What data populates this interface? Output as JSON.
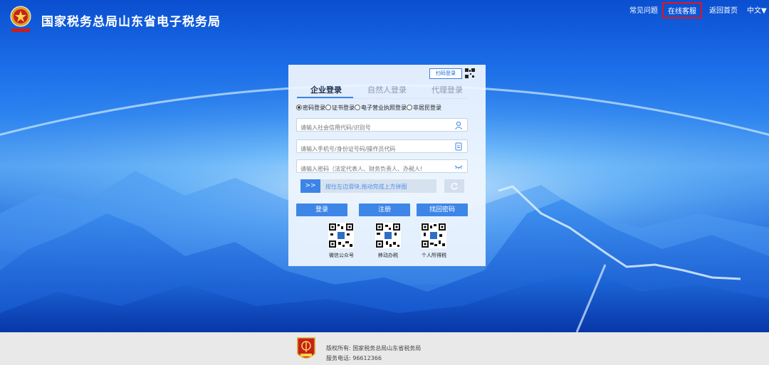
{
  "header": {
    "title": "国家税务总局山东省电子税务局",
    "nav": {
      "faq": "常见问题",
      "online_service": "在线客服",
      "home": "返回首页",
      "language": "中文▼"
    }
  },
  "login": {
    "scan_login": "扫码登录",
    "tabs": [
      {
        "label": "企业登录",
        "active": true
      },
      {
        "label": "自然人登录",
        "active": false
      },
      {
        "label": "代理登录",
        "active": false
      }
    ],
    "modes": [
      {
        "label": "密码登录",
        "selected": true
      },
      {
        "label": "证书登录",
        "selected": false
      },
      {
        "label": "电子营业执照登录",
        "selected": false
      },
      {
        "label": "非居民登录",
        "selected": false
      }
    ],
    "fields": {
      "credit_code_placeholder": "请输入社会信用代码/识别号",
      "id_placeholder": "请输入手机号/身份证号码/操作员代码",
      "password_placeholder": "请输入密码（法定代表人、财务负责人、办税人!"
    },
    "slider": {
      "handle": ">>",
      "text": "按住左边滑块,拖动完成上方拼图"
    },
    "buttons": {
      "login": "登录",
      "register": "注册",
      "forgot": "找回密码"
    },
    "qrcodes": [
      {
        "label": "微信公众号"
      },
      {
        "label": "移动办税"
      },
      {
        "label": "个人所得税"
      }
    ]
  },
  "footer": {
    "copyright": "版权所有: 国家税务总局山东省税务局",
    "phone": "服务电话: 96612366"
  },
  "colors": {
    "accent": "#3d86e8",
    "highlight_border": "#e0161b"
  }
}
